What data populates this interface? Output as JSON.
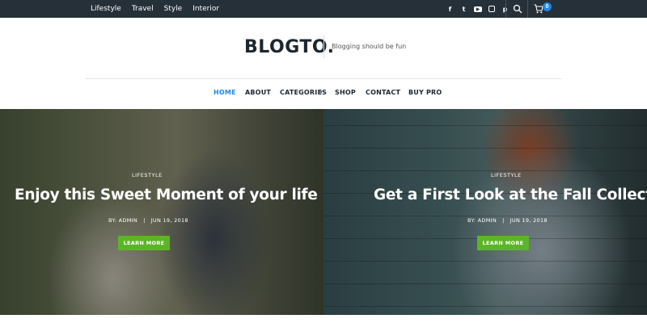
{
  "topbar": {
    "nav": [
      "Lifestyle",
      "Travel",
      "Style",
      "Interior"
    ],
    "social_icons": [
      "facebook-icon",
      "twitter-icon",
      "youtube-icon",
      "instagram-icon",
      "pinterest-icon"
    ],
    "cart_count": "0"
  },
  "header": {
    "logo": "BLOGTO.",
    "tagline": "Blogging should be fun"
  },
  "mainnav": {
    "items": [
      "HOME",
      "ABOUT",
      "CATEGORIES",
      "SHOP",
      "CONTACT",
      "BUY PRO"
    ],
    "active": "HOME"
  },
  "slides": [
    {
      "category": "LIFESTYLE",
      "title": "Enjoy this Sweet Moment of your life",
      "meta": "BY: ADMIN   |   JUN 19, 2018",
      "button": "LEARN MORE"
    },
    {
      "category": "LIFESTYLE",
      "title": "Get a First Look at the Fall Collection",
      "meta": "BY: ADMIN   |   JUN 19, 2018",
      "button": "LEARN MORE"
    }
  ],
  "colors": {
    "topbar_bg": "#263038",
    "accent": "#1e88e5",
    "button_green": "#5cb527"
  }
}
